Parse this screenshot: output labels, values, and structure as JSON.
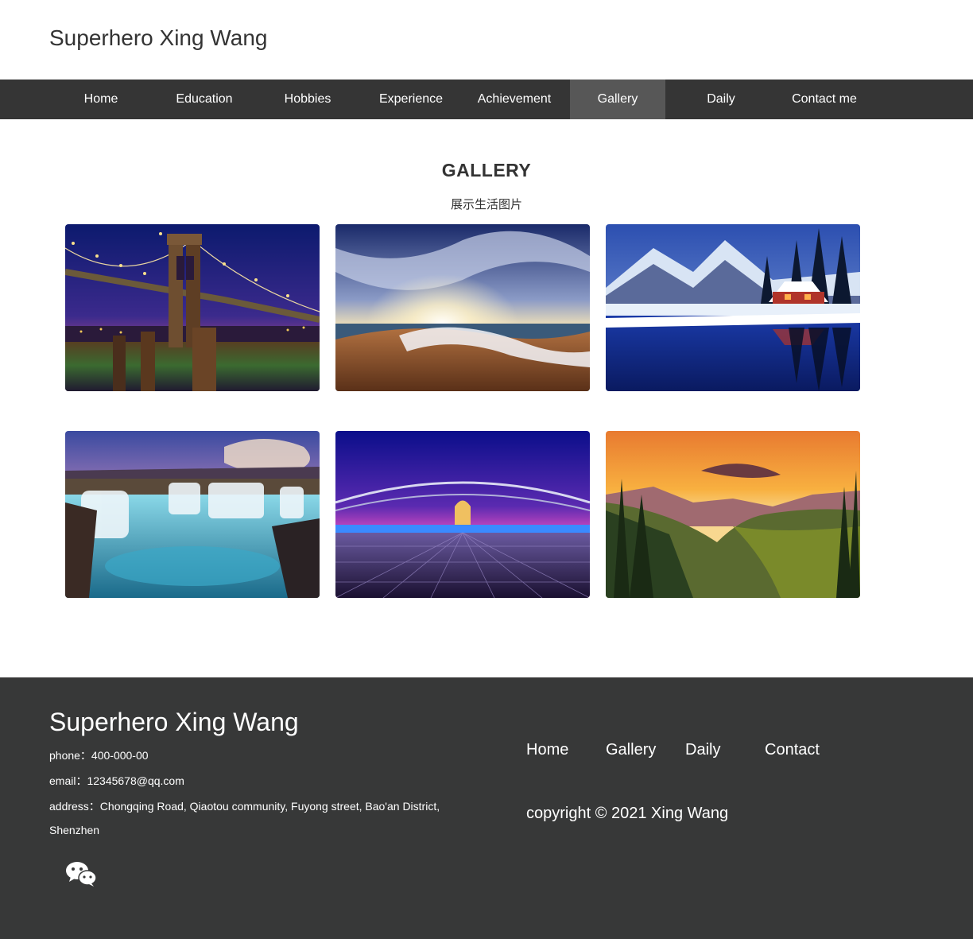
{
  "header": {
    "title": "Superhero Xing Wang"
  },
  "nav": {
    "items": [
      "Home",
      "Education",
      "Hobbies",
      "Experience",
      "Achievement",
      "Gallery",
      "Daily",
      "Contact me"
    ],
    "active": "Gallery"
  },
  "gallery": {
    "title": "GALLERY",
    "subtitle": "展示生活图片",
    "photos": [
      {
        "subject": "brooklyn-bridge-night"
      },
      {
        "subject": "beach-sunrise-waves"
      },
      {
        "subject": "snowy-cabin-lake"
      },
      {
        "subject": "waterfall-canyon"
      },
      {
        "subject": "futuristic-bridge-purple-sky"
      },
      {
        "subject": "mountain-valley-sunset"
      }
    ]
  },
  "footer": {
    "title": "Superhero Xing Wang",
    "phone": "phone：400-000-00",
    "email": "email：12345678@qq.com",
    "address_line1": "address：Chongqing Road, Qiaotou community, Fuyong street, Bao'an District,",
    "address_line2": "Shenzhen",
    "links": [
      "Home",
      "Gallery",
      "Daily",
      "Contact"
    ],
    "copyright": "copyright © 2021 Xing Wang",
    "social_icon": "wechat-icon"
  },
  "colors": {
    "nav_bg": "#353535",
    "nav_active": "#575757",
    "footer_bg": "#373838",
    "text": "#333333"
  }
}
